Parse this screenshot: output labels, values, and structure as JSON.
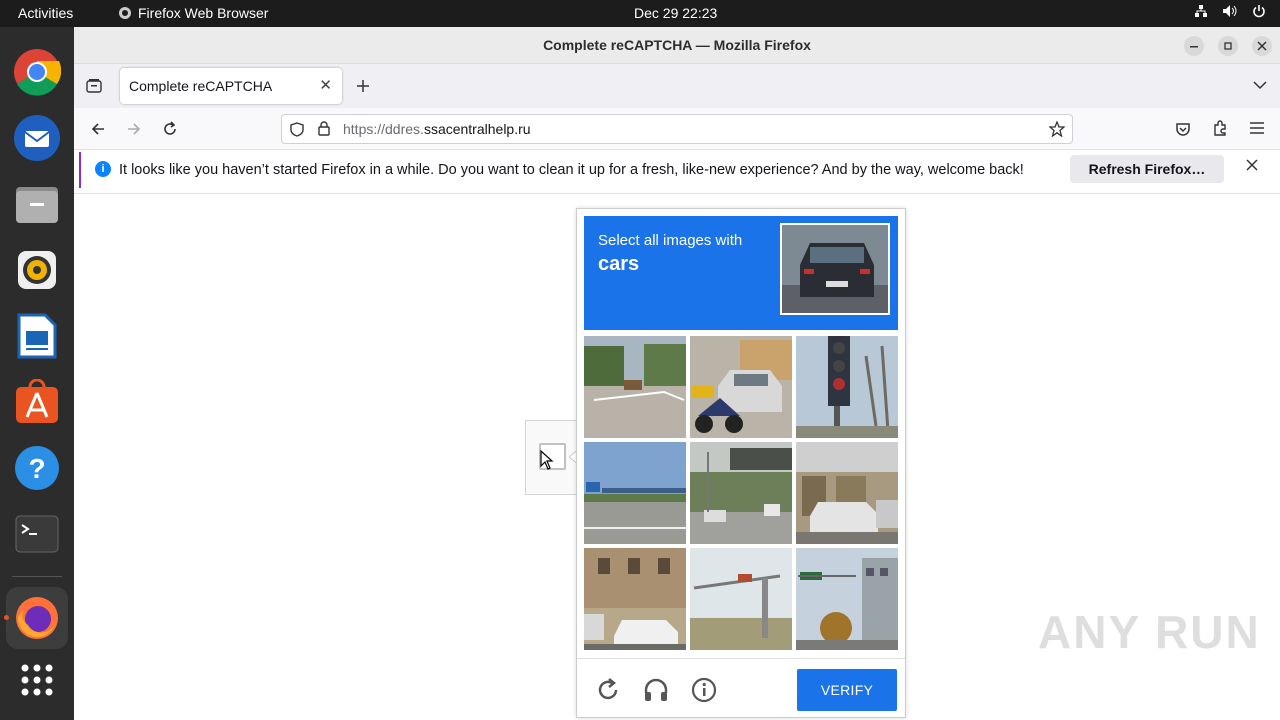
{
  "topbar": {
    "activities": "Activities",
    "app_name": "Firefox Web Browser",
    "clock": "Dec 29  22:23"
  },
  "dock": {
    "items": [
      "chrome-icon",
      "thunderbird-icon",
      "files-icon",
      "rhythmbox-icon",
      "writer-icon",
      "app-center-icon",
      "help-icon",
      "terminal-icon",
      "firefox-icon",
      "app-grid-icon"
    ]
  },
  "window": {
    "title": "Complete reCAPTCHA — Mozilla Firefox"
  },
  "tabs": [
    {
      "label": "Complete reCAPTCHA"
    }
  ],
  "urlbar": {
    "prefix": "https://ddres.",
    "domain": "ssacentralhelp.ru"
  },
  "notification": {
    "message": "It looks like you haven’t started Firefox in a while. Do you want to clean it up for a fresh, like-new experience? And by the way, welcome back!",
    "button": "Refresh Firefox…"
  },
  "captcha": {
    "instruction": "Select all images with",
    "target": "cars",
    "verify_label": "VERIFY"
  },
  "watermark": "ANY RUN",
  "colors": {
    "accent": "#1a73e8",
    "topbar": "#1c1c1c",
    "dock": "#2c2c2c"
  }
}
